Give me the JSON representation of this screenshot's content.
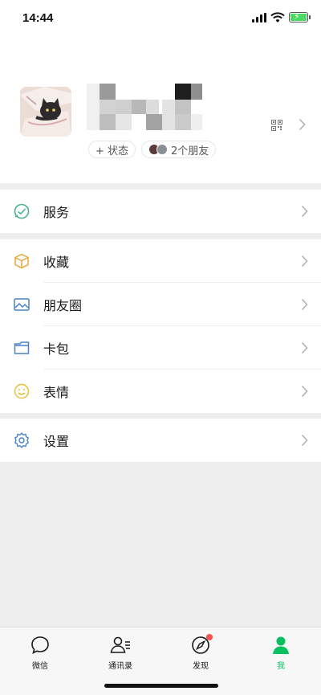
{
  "status_bar": {
    "time": "14:44"
  },
  "profile": {
    "status_chip": "+ 状态",
    "friends_chip": "2个朋友"
  },
  "menu": {
    "services": "服务",
    "favorites": "收藏",
    "moments": "朋友圈",
    "cards": "卡包",
    "stickers": "表情",
    "settings": "设置"
  },
  "tabs": {
    "chats": "微信",
    "contacts": "通讯录",
    "discover": "发现",
    "me": "我"
  },
  "colors": {
    "accent": "#07c160",
    "background": "#ededed",
    "badge": "#fa5151"
  },
  "icons": {
    "services": "check-circle-icon",
    "favorites": "cube-icon",
    "moments": "picture-icon",
    "cards": "wallet-icon",
    "stickers": "smile-icon",
    "settings": "gear-icon"
  }
}
